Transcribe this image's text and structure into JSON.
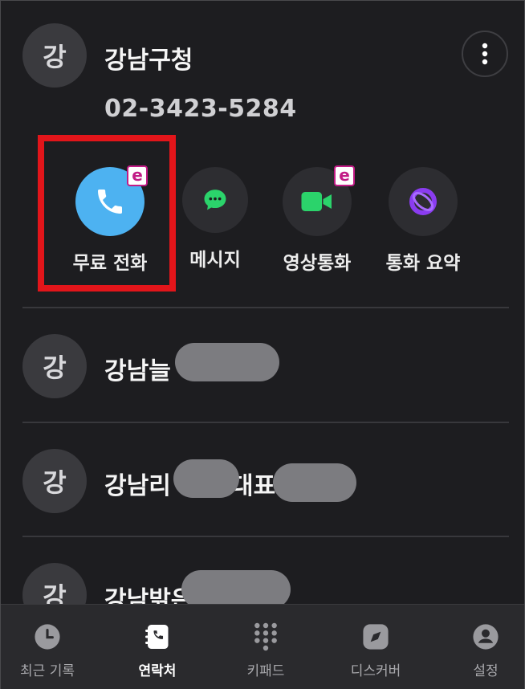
{
  "contact": {
    "avatar_initial": "강",
    "name": "강남구청",
    "phone": "02-3423-5284"
  },
  "actions": [
    {
      "label": "무료 전화",
      "icon": "phone-icon",
      "color": "#4db2f1",
      "badge": "e"
    },
    {
      "label": "메시지",
      "icon": "chat-icon",
      "color": "#2bd36b"
    },
    {
      "label": "영상통화",
      "icon": "video-camera-icon",
      "color": "#2bd36b",
      "badge": "e"
    },
    {
      "label": "통화 요약",
      "icon": "ai-summary-icon",
      "color": "#8a3cf0"
    }
  ],
  "list": [
    {
      "initial": "강",
      "name": "강남늘"
    },
    {
      "initial": "강",
      "name_a": "강남리",
      "name_b": "대표"
    },
    {
      "initial": "강",
      "name": "강남밝은"
    }
  ],
  "tabs": [
    {
      "label": "최근 기록",
      "icon": "clock-icon"
    },
    {
      "label": "연락처",
      "icon": "contacts-book-icon",
      "active": true
    },
    {
      "label": "키패드",
      "icon": "keypad-icon"
    },
    {
      "label": "디스커버",
      "icon": "compass-icon"
    },
    {
      "label": "설정",
      "icon": "person-icon"
    }
  ],
  "colors": {
    "highlight": "#e2151a",
    "badge": "#c21b86",
    "background": "#1d1d20"
  }
}
